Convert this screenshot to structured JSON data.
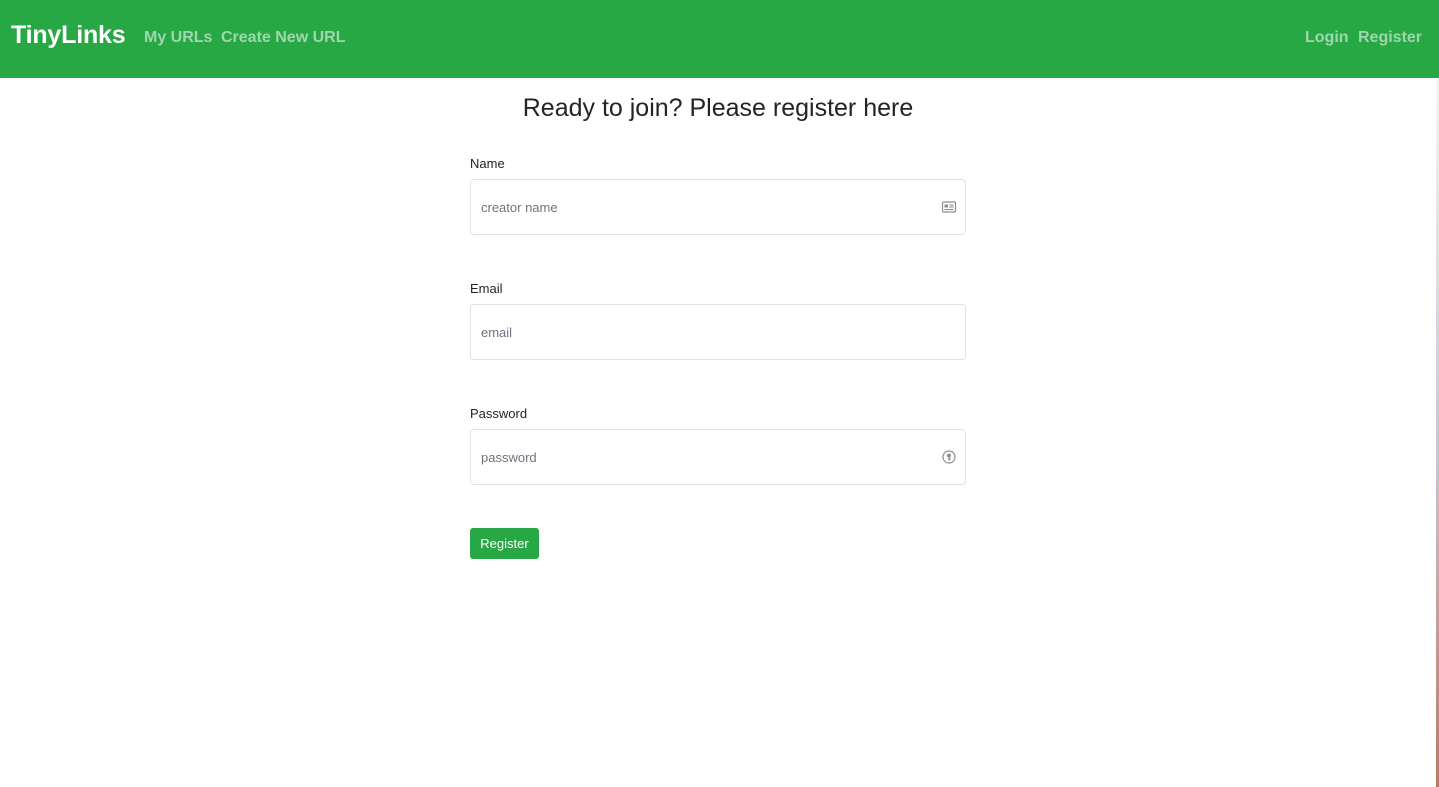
{
  "navbar": {
    "brand": "TinyLinks",
    "links": {
      "my_urls": "My URLs",
      "create_new_url": "Create New URL",
      "login": "Login",
      "register": "Register"
    },
    "background_color": "#28a745"
  },
  "page": {
    "title": "Ready to join? Please register here"
  },
  "form": {
    "name": {
      "label": "Name",
      "placeholder": "creator name",
      "value": "",
      "icon": "contact-card-icon"
    },
    "email": {
      "label": "Email",
      "placeholder": "email",
      "value": ""
    },
    "password": {
      "label": "Password",
      "placeholder": "password",
      "value": "",
      "icon": "password-key-icon"
    },
    "submit_label": "Register",
    "submit_color": "#28a745"
  }
}
